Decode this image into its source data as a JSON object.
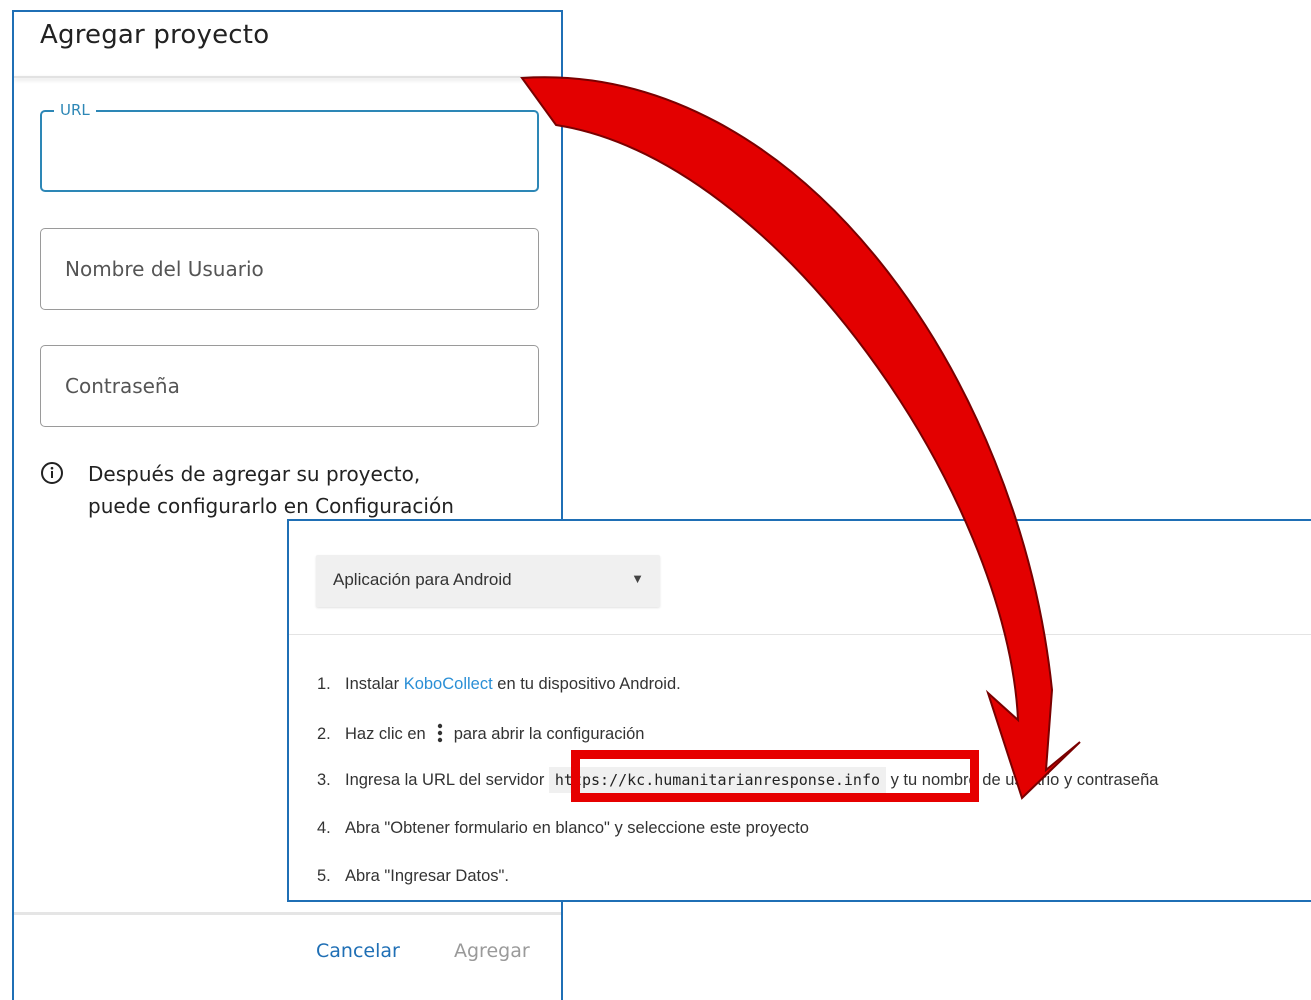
{
  "dialog": {
    "title": "Agregar proyecto",
    "fields": {
      "url": {
        "label": "URL",
        "value": ""
      },
      "username": {
        "placeholder": "Nombre del Usuario"
      },
      "password": {
        "placeholder": "Contraseña"
      }
    },
    "info": {
      "line1": "Después de agregar su proyecto,",
      "line2": "puede configurarlo en Configuración"
    },
    "buttons": {
      "cancel": "Cancelar",
      "add": "Agregar"
    }
  },
  "panel": {
    "select_value": "Aplicación para Android",
    "steps": {
      "s1": {
        "num": "1.",
        "pre": "Instalar ",
        "link": "KoboCollect",
        "post": " en tu dispositivo Android."
      },
      "s2": {
        "num": "2.",
        "pre": "Haz clic en",
        "post": "para abrir la configuración"
      },
      "s3": {
        "num": "3.",
        "pre": "Ingresa la URL del servidor ",
        "code": "https://kc.humanitarianresponse.info",
        "post": " y tu nombre de usuario y contraseña"
      },
      "s4": {
        "num": "4.",
        "text": "Abra \"Obtener formulario en blanco\" y seleccione este proyecto"
      },
      "s5": {
        "num": "5.",
        "text": "Abra \"Ingresar Datos\"."
      }
    }
  },
  "colors": {
    "accent_blue": "#1f6fb5",
    "link_blue": "#2a8fd6",
    "highlight_red": "#e60000"
  },
  "icons": [
    "info-icon",
    "kebab-menu-icon",
    "dropdown-arrow-icon",
    "curved-arrow-icon"
  ]
}
